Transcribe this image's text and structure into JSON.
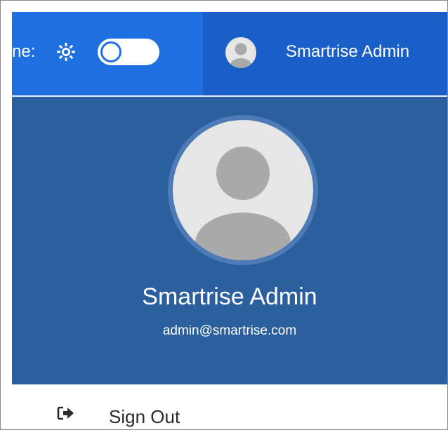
{
  "header": {
    "theme_label": "ne:",
    "theme_toggle": {
      "mode": "light",
      "icons": [
        "sun-icon",
        "moon-icon"
      ]
    },
    "user": {
      "name": "Smartrise Admin",
      "avatar_icon": "user-avatar-icon"
    }
  },
  "profile": {
    "name": "Smartrise Admin",
    "email": "admin@smartrise.com",
    "avatar_icon": "user-avatar-icon"
  },
  "menu": {
    "sign_out": {
      "label": "Sign Out",
      "icon": "sign-out-icon"
    }
  },
  "colors": {
    "topbar": "#1e6fe0",
    "topbar_user_section": "#1a5fc7",
    "profile_panel": "#2c5f9e",
    "avatar_ring": "#4d7bb6",
    "avatar_bg": "#e6e6e6",
    "avatar_figure": "#a9a9a9"
  }
}
